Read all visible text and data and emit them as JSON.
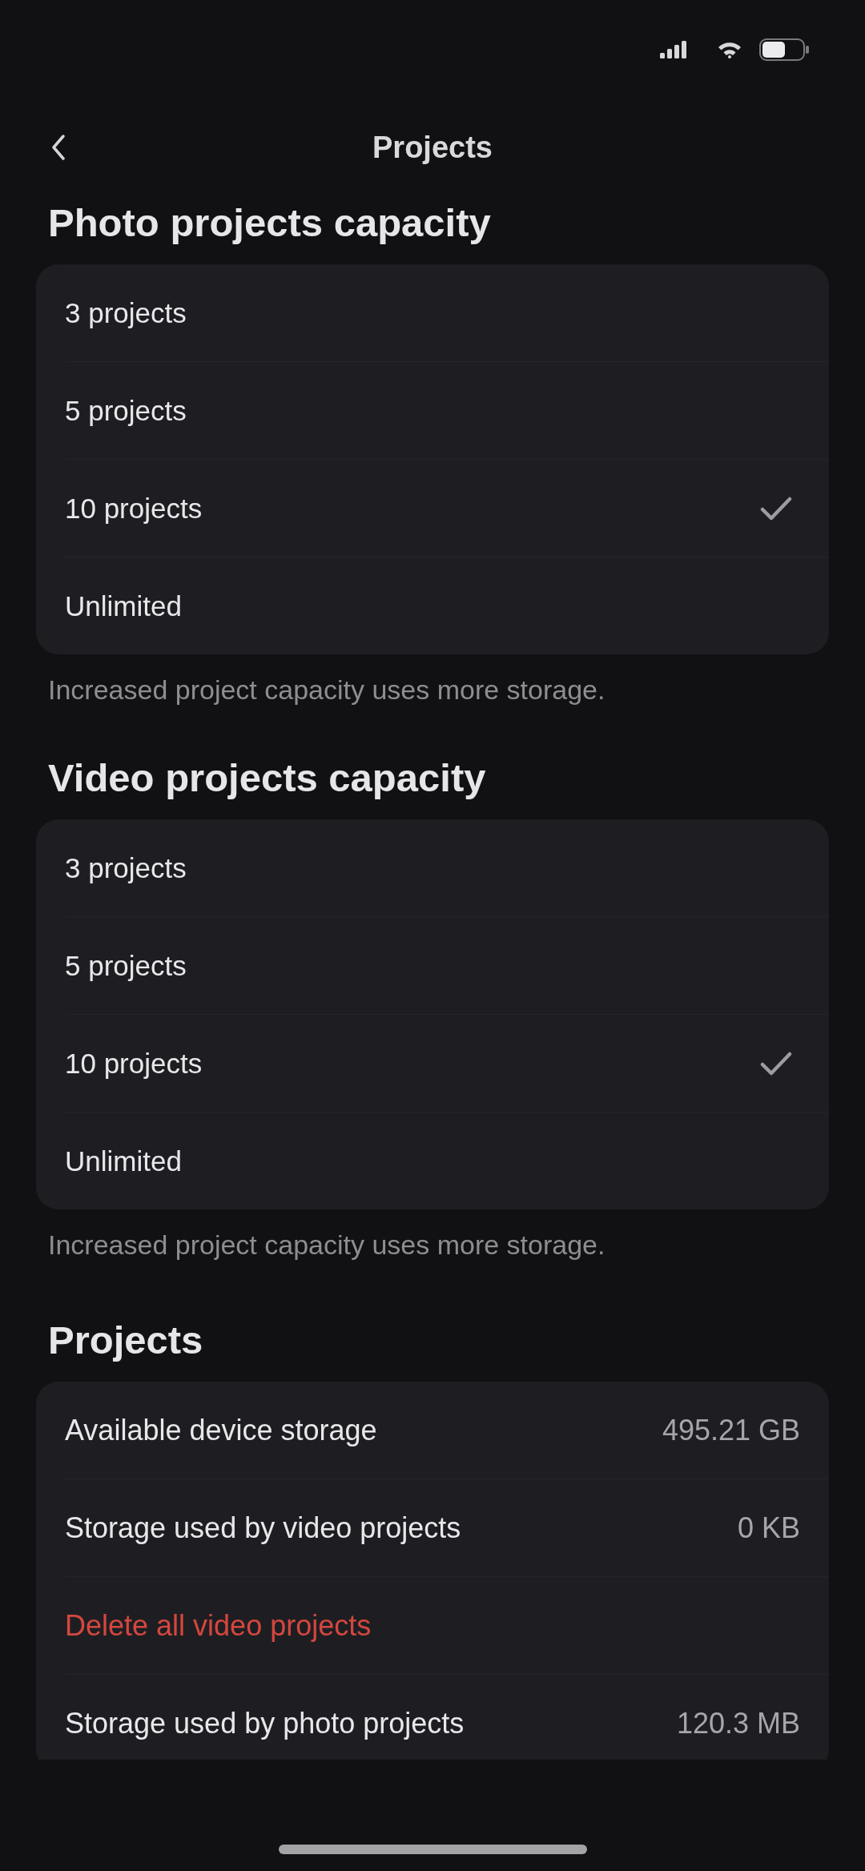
{
  "nav_bar": {
    "title": "Projects"
  },
  "sections": [
    {
      "kind": "choice",
      "title": "Photo projects capacity",
      "options": [
        {
          "label": "3 projects",
          "selected": false
        },
        {
          "label": "5 projects",
          "selected": false
        },
        {
          "label": "10 projects",
          "selected": true
        },
        {
          "label": "Unlimited",
          "selected": false
        }
      ],
      "footnote": "Increased project capacity uses more storage."
    },
    {
      "kind": "choice",
      "title": "Video projects capacity",
      "options": [
        {
          "label": "3 projects",
          "selected": false
        },
        {
          "label": "5 projects",
          "selected": false
        },
        {
          "label": "10 projects",
          "selected": true
        },
        {
          "label": "Unlimited",
          "selected": false
        }
      ],
      "footnote": "Increased project capacity uses more storage."
    },
    {
      "kind": "info",
      "title": "Projects",
      "rows": [
        {
          "kind": "value",
          "label": "Available device storage",
          "value": "495.21 GB"
        },
        {
          "kind": "value",
          "label": "Storage used by video projects",
          "value": "0 KB"
        },
        {
          "kind": "action",
          "label": "Delete all video projects"
        },
        {
          "kind": "value",
          "label": "Storage used by photo projects",
          "value": "120.3 MB"
        }
      ]
    }
  ]
}
